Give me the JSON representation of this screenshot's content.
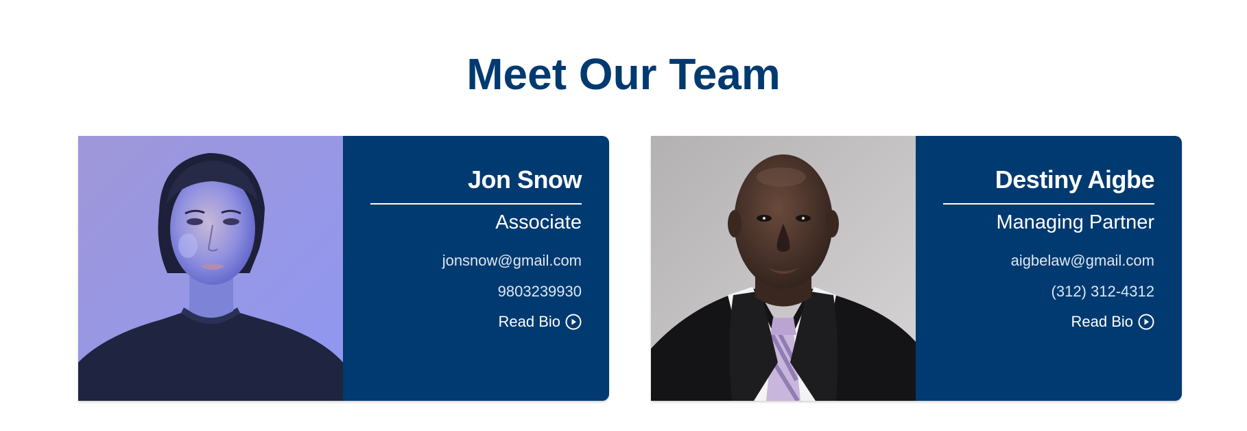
{
  "section": {
    "title": "Meet Our Team"
  },
  "colors": {
    "title": "#003a70",
    "panel": "#003a70",
    "text": "#ffffff"
  },
  "members": [
    {
      "name": "Jon Snow",
      "role": "Associate",
      "email": "jonsnow@gmail.com",
      "phone": "9803239930",
      "bio_label": "Read Bio",
      "bio_icon": "play-circle-icon",
      "photo": "portrait-woman-photo"
    },
    {
      "name": "Destiny Aigbe",
      "role": "Managing Partner",
      "email": "aigbelaw@gmail.com",
      "phone": "(312) 312-4312",
      "bio_label": "Read Bio",
      "bio_icon": "play-circle-icon",
      "photo": "portrait-man-photo"
    }
  ]
}
